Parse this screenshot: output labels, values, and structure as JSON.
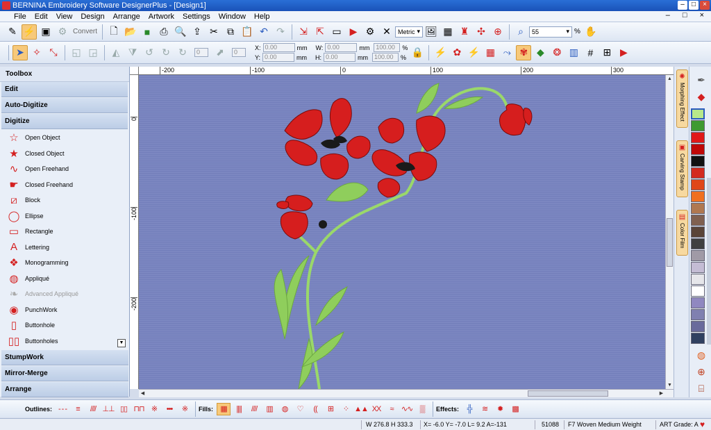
{
  "window": {
    "title": "BERNINA Embroidery Software DesignerPlus - [Design1]"
  },
  "menu": [
    "File",
    "Edit",
    "View",
    "Design",
    "Arrange",
    "Artwork",
    "Settings",
    "Window",
    "Help"
  ],
  "toolbar1": {
    "convert_label": "Convert",
    "units": "Metric",
    "zoom_value": "55",
    "zoom_unit": "%"
  },
  "toolbar2": {
    "x_label": "X:",
    "y_label": "Y:",
    "w_label": "W:",
    "h_label": "H:",
    "x_value": "0.00",
    "y_value": "0.00",
    "w_value": "0.00",
    "h_value": "0.00",
    "unit_mm": "mm",
    "pct_w": "100.00",
    "pct_h": "100.00",
    "pct": "%",
    "rotate_value": "0"
  },
  "toolbox": {
    "title": "Toolbox",
    "categories_top": [
      "Edit",
      "Auto-Digitize",
      "Digitize"
    ],
    "tools": [
      {
        "label": "Open Object",
        "icon": "open-object-icon",
        "glyph": "☆",
        "enabled": true
      },
      {
        "label": "Closed Object",
        "icon": "closed-object-icon",
        "glyph": "★",
        "enabled": true
      },
      {
        "label": "Open Freehand",
        "icon": "open-freehand-icon",
        "glyph": "∿",
        "enabled": true
      },
      {
        "label": "Closed Freehand",
        "icon": "closed-freehand-icon",
        "glyph": "☛",
        "enabled": true
      },
      {
        "label": "Block",
        "icon": "block-icon",
        "glyph": "⧄",
        "enabled": true
      },
      {
        "label": "Ellipse",
        "icon": "ellipse-icon",
        "glyph": "◯",
        "enabled": true
      },
      {
        "label": "Rectangle",
        "icon": "rectangle-icon",
        "glyph": "▭",
        "enabled": true
      },
      {
        "label": "Lettering",
        "icon": "lettering-icon",
        "glyph": "A",
        "enabled": true
      },
      {
        "label": "Monogramming",
        "icon": "monogramming-icon",
        "glyph": "❖",
        "enabled": true
      },
      {
        "label": "Appliqué",
        "icon": "applique-icon",
        "glyph": "◍",
        "enabled": true
      },
      {
        "label": "Advanced Appliqué",
        "icon": "advanced-applique-icon",
        "glyph": "❧",
        "enabled": false
      },
      {
        "label": "PunchWork",
        "icon": "punchwork-icon",
        "glyph": "◉",
        "enabled": true
      },
      {
        "label": "Buttonhole",
        "icon": "buttonhole-icon",
        "glyph": "▯",
        "enabled": true
      },
      {
        "label": "Buttonholes",
        "icon": "buttonholes-icon",
        "glyph": "▯▯",
        "enabled": true
      }
    ],
    "categories_bottom": [
      "StumpWork",
      "Mirror-Merge",
      "Arrange"
    ]
  },
  "ruler": {
    "h_ticks": [
      "-200",
      "-100",
      "0",
      "100",
      "200",
      "300"
    ],
    "v_ticks": [
      "0",
      "-100",
      "-200"
    ]
  },
  "side_tabs": [
    "Morphing Effect",
    "Carving Stamp",
    "Color Film"
  ],
  "palette": {
    "colors": [
      "#b8e98a",
      "#3f9a30",
      "#e01818",
      "#c00808",
      "#111111",
      "#d32a1e",
      "#e0471a",
      "#f07020",
      "#b07850",
      "#806050",
      "#5a4438",
      "#404040",
      "#a09aa6",
      "#c4bcd4",
      "#e6e6ea",
      "#ffffff",
      "#9088c0",
      "#8080b0",
      "#6a6a9c",
      "#304060"
    ]
  },
  "bottombar": {
    "outlines_label": "Outlines:",
    "fills_label": "Fills:",
    "effects_label": "Effects:"
  },
  "status": {
    "size": "W 276.8 H 333.3",
    "coords": "X=  -6.0 Y=  -7.0 L=  9.2 A=-131",
    "stitches": "51088",
    "fabric": "F7 Woven Medium Weight",
    "grade": "ART Grade: A"
  }
}
